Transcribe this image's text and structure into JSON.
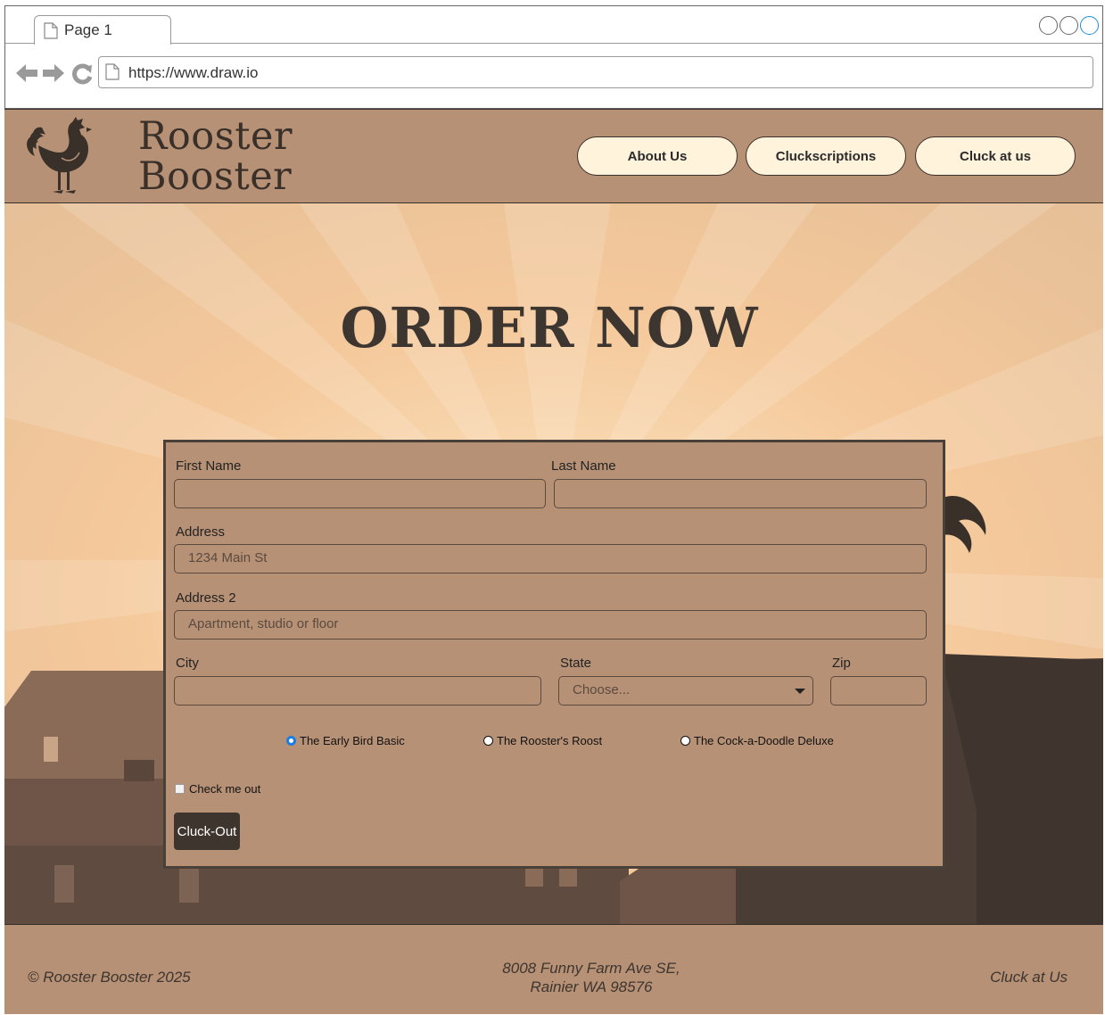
{
  "browser": {
    "tab_label": "Page 1",
    "url": "https://www.draw.io"
  },
  "header": {
    "brand_line1": "Rooster",
    "brand_line2": "Booster",
    "nav": [
      "About Us",
      "Cluckscriptions",
      "Cluck at us"
    ]
  },
  "hero": {
    "title": "ORDER NOW"
  },
  "form": {
    "first_name_label": "First Name",
    "last_name_label": "Last Name",
    "address_label": "Address",
    "address_placeholder": "1234 Main St",
    "address2_label": "Address 2",
    "address2_placeholder": "Apartment, studio or floor",
    "city_label": "City",
    "state_label": "State",
    "state_selected": "Choose...",
    "zip_label": "Zip",
    "plans": [
      {
        "label": "The Early Bird Basic",
        "selected": true
      },
      {
        "label": "The Rooster's Roost",
        "selected": false
      },
      {
        "label": "The Cock-a-Doodle Deluxe",
        "selected": false
      }
    ],
    "checkbox_label": "Check me out",
    "checkbox_checked": false,
    "submit_label": "Cluck-Out"
  },
  "footer": {
    "copyright": "© Rooster Booster 2025",
    "address_line1": "8008 Funny Farm Ave SE,",
    "address_line2": "Rainier WA 98576",
    "contact": "Cluck at Us"
  },
  "colors": {
    "header_bg": "#b79175",
    "dark_brown": "#3a302a",
    "pill_bg": "#fff3dc",
    "radio_accent": "#1a7ee6"
  }
}
